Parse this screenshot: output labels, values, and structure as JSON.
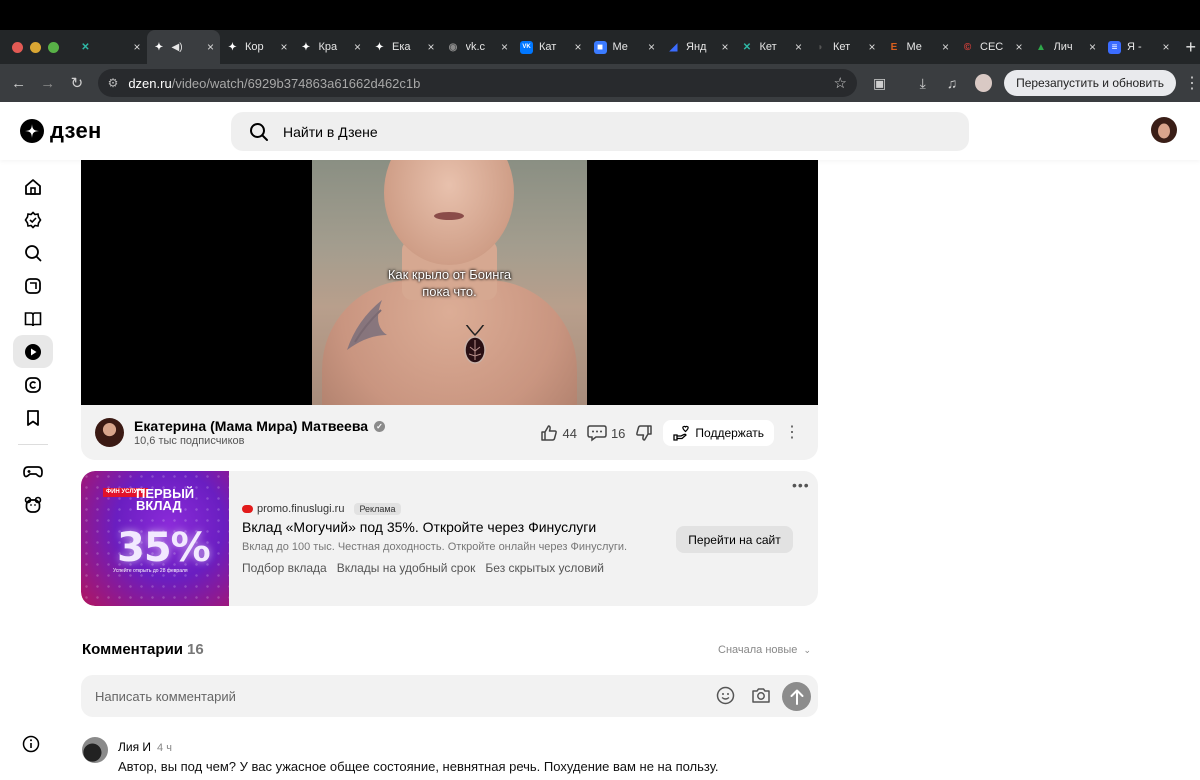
{
  "browser": {
    "tabs": [
      {
        "label": "",
        "favicon": "x-brand-icon",
        "color": "#2fb9a7"
      },
      {
        "label": "",
        "favicon": "dzen-icon",
        "color": "#ffffff",
        "active": true
      },
      {
        "label": "Кор",
        "favicon": "dzen-icon",
        "color": "#ffffff"
      },
      {
        "label": "Кра",
        "favicon": "dzen-icon",
        "color": "#ffffff"
      },
      {
        "label": "Ека",
        "favicon": "dzen-icon",
        "color": "#ffffff"
      },
      {
        "label": "vk.c",
        "favicon": "globe-icon",
        "color": "#888888"
      },
      {
        "label": "Кат",
        "favicon": "vk-icon",
        "color": "#0077ff"
      },
      {
        "label": "Ме",
        "favicon": "messenger-icon",
        "color": "#3b7bff"
      },
      {
        "label": "Янд",
        "favicon": "yandex-icon",
        "color": "#3b6cff"
      },
      {
        "label": "Кет",
        "favicon": "x-brand-icon",
        "color": "#2fb9a7"
      },
      {
        "label": "Кет",
        "favicon": "doc-icon",
        "color": "#555555"
      },
      {
        "label": "Ме",
        "favicon": "e-brand-icon",
        "color": "#d95f1e"
      },
      {
        "label": "СЕС",
        "favicon": "copyright-icon",
        "color": "#e0413b"
      },
      {
        "label": "Лич",
        "favicon": "drive-icon",
        "color": "#2ea84a"
      },
      {
        "label": "Я -",
        "favicon": "docs-icon",
        "color": "#3b6cff"
      }
    ],
    "url_domain": "dzen.ru",
    "url_path": "/video/watch/6929b374863a61662d462c1b",
    "restart_label": "Перезапустить и обновить"
  },
  "header": {
    "logo_text": "дзен",
    "search_placeholder": "Найти в Дзене"
  },
  "video": {
    "subtitle_line1": "Как крыло от Боинга",
    "subtitle_line2": "пока что."
  },
  "channel": {
    "name": "Екатерина (Мама Мира) Матвеева",
    "subscribers": "10,6 тыс подписчиков",
    "likes": "44",
    "comments": "16",
    "support_label": "Поддержать"
  },
  "ad": {
    "image": {
      "badge": "ФИН УСЛУГИ",
      "headline": "ПЕРВЫЙ ВКЛАД",
      "percent": "35%",
      "footer": "Успейте открыть до 28 февраля"
    },
    "domain": "promo.finuslugi.ru",
    "tag": "Реклама",
    "title": "Вклад «Могучий» под 35%. Откройте через Финуслуги",
    "description": "Вклад до 100 тыс. Честная доходность. Откройте онлайн через Финуслуги.",
    "links": [
      "Подбор вклада",
      "Вклады на удобный срок",
      "Без скрытых условий"
    ],
    "button": "Перейти на сайт"
  },
  "comments": {
    "heading": "Комментарии",
    "count": "16",
    "sort": "Сначала новые",
    "input_placeholder": "Написать комментарий",
    "items": [
      {
        "author": "Лия И",
        "time": "4 ч",
        "text": "Автор, вы под чем? У вас ужасное общее состояние, невнятная речь. Похудение вам не на пользу."
      }
    ]
  }
}
